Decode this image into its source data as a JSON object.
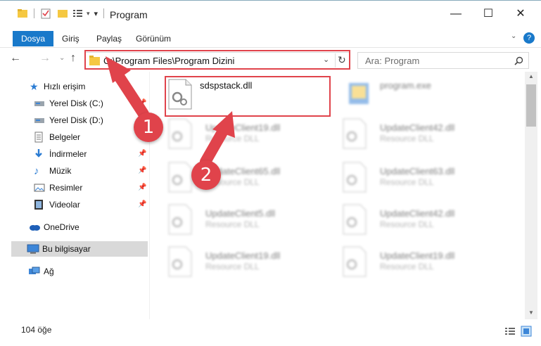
{
  "window": {
    "title": "Program",
    "minimize_icon": "minimize-icon",
    "maximize_icon": "maximize-icon",
    "close_icon": "close-icon"
  },
  "ribbon": {
    "tabs": [
      {
        "label": "Dosya",
        "active": true
      },
      {
        "label": "Giriş",
        "active": false
      },
      {
        "label": "Paylaş",
        "active": false
      },
      {
        "label": "Görünüm",
        "active": false
      }
    ]
  },
  "navigation": {
    "address": "C:\\Program Files\\Program Dizini",
    "search_placeholder": "Ara: Program"
  },
  "sidebar": {
    "items": [
      {
        "label": "Hızlı erişim",
        "icon": "star-icon",
        "pinned": false
      },
      {
        "label": "Yerel Disk (C:)",
        "icon": "drive-icon",
        "pinned": true
      },
      {
        "label": "Yerel Disk (D:)",
        "icon": "drive-icon",
        "pinned": false
      },
      {
        "label": "Belgeler",
        "icon": "documents-icon",
        "pinned": false
      },
      {
        "label": "İndirmeler",
        "icon": "download-icon",
        "pinned": true
      },
      {
        "label": "Müzik",
        "icon": "music-icon",
        "pinned": true
      },
      {
        "label": "Resimler",
        "icon": "pictures-icon",
        "pinned": true
      },
      {
        "label": "Videolar",
        "icon": "videos-icon",
        "pinned": true
      },
      {
        "label": "OneDrive",
        "icon": "cloud-icon",
        "pinned": false
      },
      {
        "label": "Bu bilgisayar",
        "icon": "computer-icon",
        "pinned": false,
        "selected": true
      },
      {
        "label": "Ağ",
        "icon": "network-icon",
        "pinned": false
      }
    ]
  },
  "files": {
    "highlighted": {
      "name": "sdspstack.dll",
      "type": ""
    },
    "program": {
      "name": "program.exe",
      "type": ""
    },
    "items": [
      {
        "name": "UpdateClient19.dll",
        "type": "Resource DLL"
      },
      {
        "name": "UpdateClient42.dll",
        "type": "Resource DLL"
      },
      {
        "name": "UpdateClient65.dll",
        "type": "Resource DLL"
      },
      {
        "name": "UpdateClient63.dll",
        "type": "Resource DLL"
      },
      {
        "name": "UpdateClient5.dll",
        "type": "Resource DLL"
      },
      {
        "name": "UpdateClient42.dll",
        "type": "Resource DLL"
      },
      {
        "name": "UpdateClient19.dll",
        "type": "Resource DLL"
      },
      {
        "name": "UpdateClient19.dll",
        "type": "Resource DLL"
      }
    ]
  },
  "status": {
    "count": "104 öğe"
  },
  "annotations": {
    "step1": "1",
    "step2": "2",
    "color": "#e0434b"
  },
  "colors": {
    "accent": "#1979ca",
    "selected_bg": "#d9d9d9"
  }
}
